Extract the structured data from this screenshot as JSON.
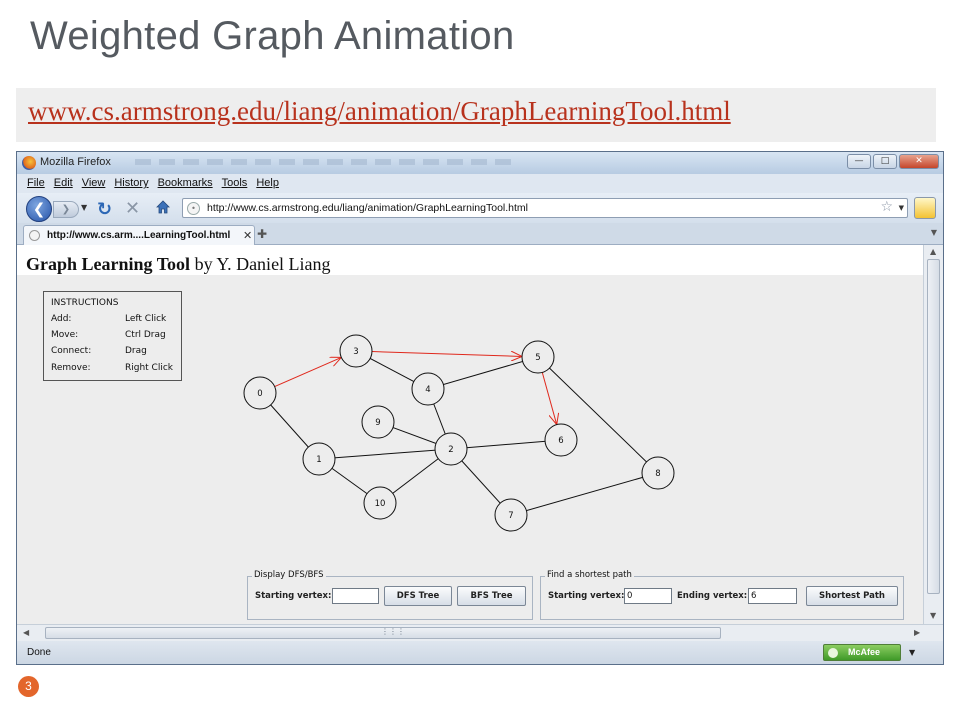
{
  "slide": {
    "title": "Weighted Graph Animation",
    "link": "www.cs.armstrong.edu/liang/animation/GraphLearningTool.html",
    "slide_number": "3"
  },
  "browser": {
    "window_title": "Mozilla Firefox",
    "menu": [
      "File",
      "Edit",
      "View",
      "History",
      "Bookmarks",
      "Tools",
      "Help"
    ],
    "address": "http://www.cs.armstrong.edu/liang/animation/GraphLearningTool.html",
    "tab_label": "http://www.cs.arm....LearningTool.html",
    "status": "Done",
    "mcafee_label": "McAfee",
    "icons": {
      "back": "back-arrow-icon",
      "forward": "forward-arrow-icon",
      "reload": "reload-icon",
      "stop": "stop-icon",
      "home": "home-icon",
      "bookmark": "star-icon",
      "close": "close-icon"
    }
  },
  "page": {
    "heading_bold": "Graph Learning Tool",
    "heading_rest": " by Y. Daniel Liang",
    "instructions": {
      "title": "INSTRUCTIONS",
      "rows": [
        {
          "action": "Add:",
          "gesture": "Left Click"
        },
        {
          "action": "Move:",
          "gesture": "Ctrl Drag"
        },
        {
          "action": "Connect:",
          "gesture": "Drag"
        },
        {
          "action": "Remove:",
          "gesture": "Right Click"
        }
      ]
    },
    "graph": {
      "vertices": [
        "0",
        "1",
        "2",
        "3",
        "4",
        "5",
        "6",
        "7",
        "8",
        "9",
        "10"
      ],
      "edges": [
        [
          "0",
          "1"
        ],
        [
          "1",
          "2"
        ],
        [
          "1",
          "10"
        ],
        [
          "3",
          "4"
        ],
        [
          "4",
          "2"
        ],
        [
          "4",
          "5"
        ],
        [
          "9",
          "2"
        ],
        [
          "2",
          "6"
        ],
        [
          "2",
          "7"
        ],
        [
          "2",
          "10"
        ],
        [
          "5",
          "8"
        ],
        [
          "7",
          "8"
        ]
      ],
      "path_edges": [
        [
          "0",
          "3"
        ],
        [
          "3",
          "5"
        ],
        [
          "5",
          "6"
        ]
      ],
      "path_color": "#e0281c"
    },
    "dfs_panel": {
      "title": "Display DFS/BFS",
      "start_label": "Starting vertex:",
      "start_value": "",
      "dfs_button": "DFS Tree",
      "bfs_button": "BFS Tree"
    },
    "sp_panel": {
      "title": "Find a shortest path",
      "start_label": "Starting vertex:",
      "start_value": "0",
      "end_label": "Ending vertex:",
      "end_value": "6",
      "button": "Shortest Path"
    }
  },
  "colors": {
    "title_text": "#555a60",
    "link": "#b8321d",
    "badge": "#e3662b"
  }
}
